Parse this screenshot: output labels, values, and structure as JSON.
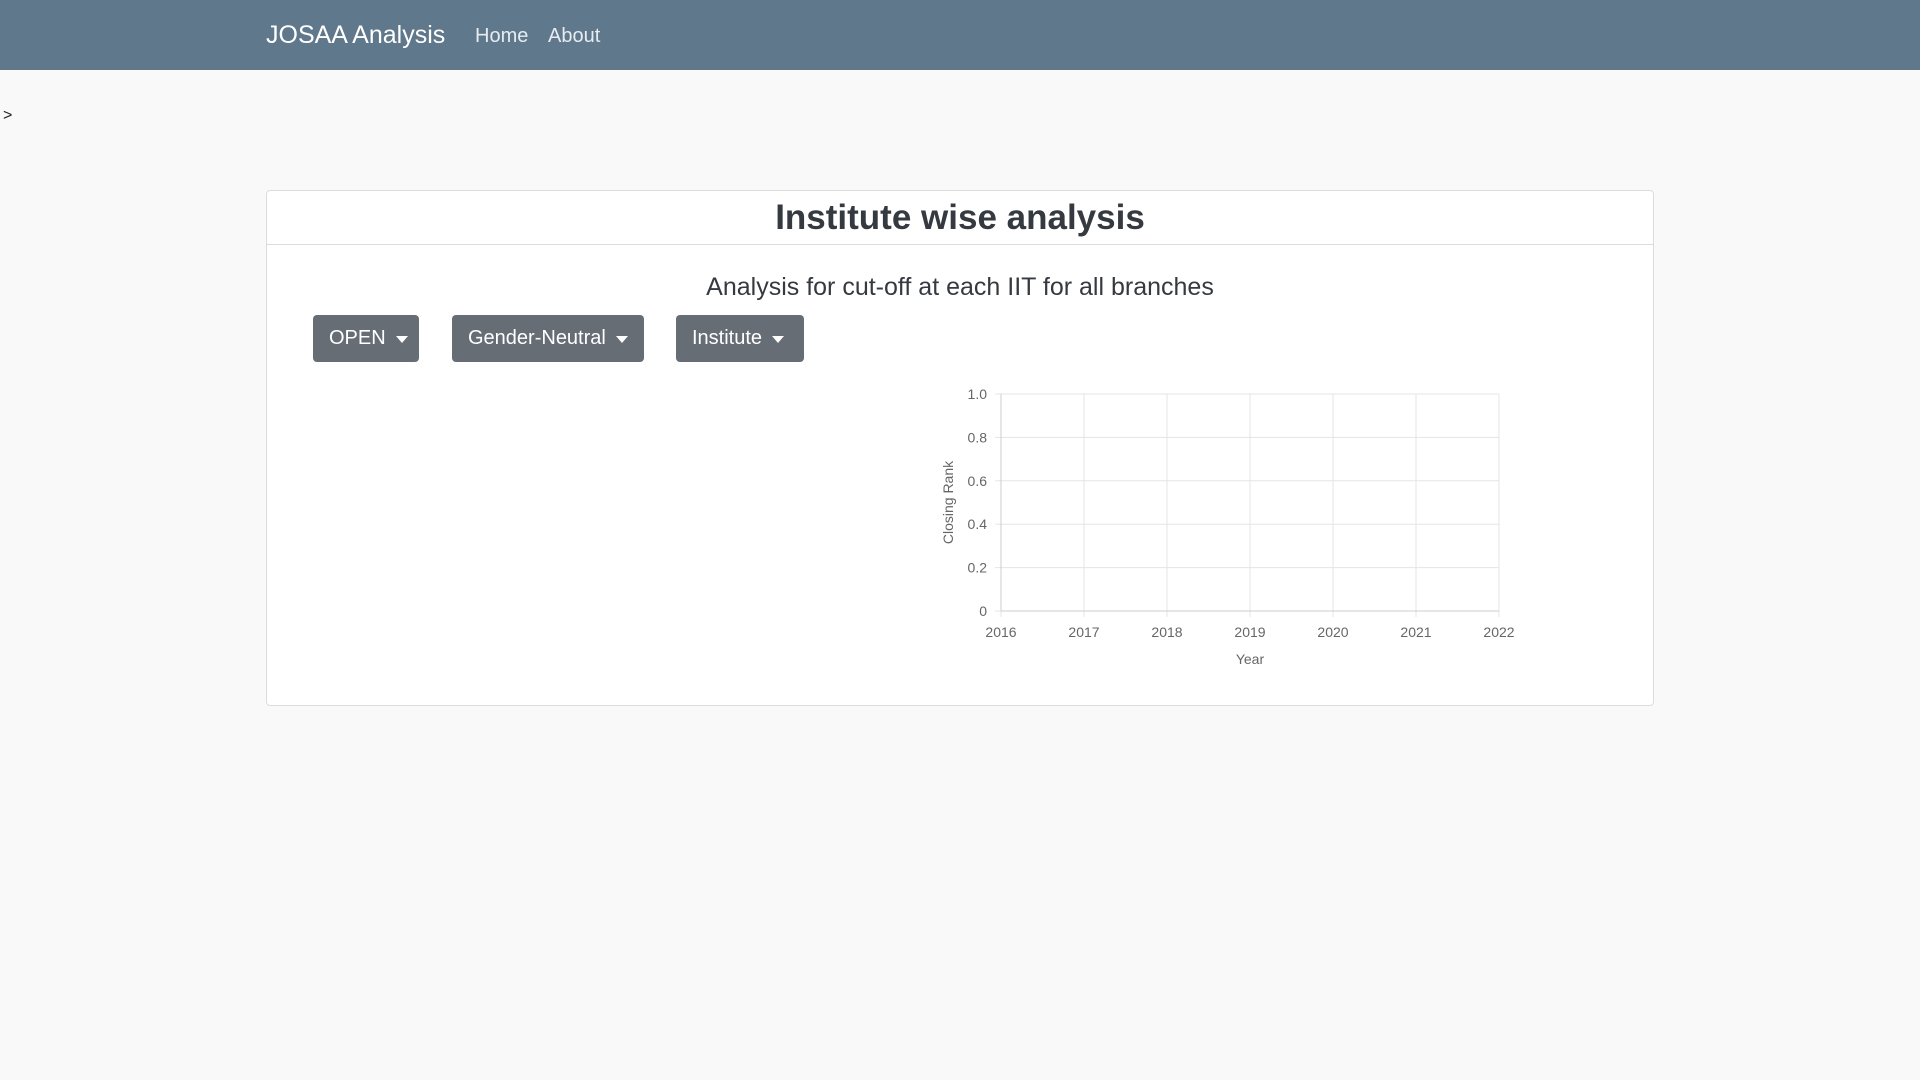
{
  "navbar": {
    "brand": "JOSAA Analysis",
    "links": [
      "Home",
      "About"
    ]
  },
  "stray_text": ">",
  "card": {
    "title": "Institute wise analysis",
    "subtitle": "Analysis for cut-off at each IIT for all branches",
    "dropdowns": [
      {
        "label": "OPEN"
      },
      {
        "label": "Gender-Neutral"
      },
      {
        "label": "Institute"
      }
    ]
  },
  "colors": {
    "navbar": "#60788b",
    "button": "#676d75",
    "background": "#f9f9f9"
  },
  "chart_data": {
    "type": "line",
    "x": [
      "2016",
      "2017",
      "2018",
      "2019",
      "2020",
      "2021",
      "2022"
    ],
    "series": [],
    "xlabel": "Year",
    "ylabel": "Closing Rank",
    "ylim": [
      0,
      1.0
    ],
    "yticks": [
      "0",
      "0.2",
      "0.4",
      "0.6",
      "0.8",
      "1.0"
    ],
    "grid": true
  }
}
